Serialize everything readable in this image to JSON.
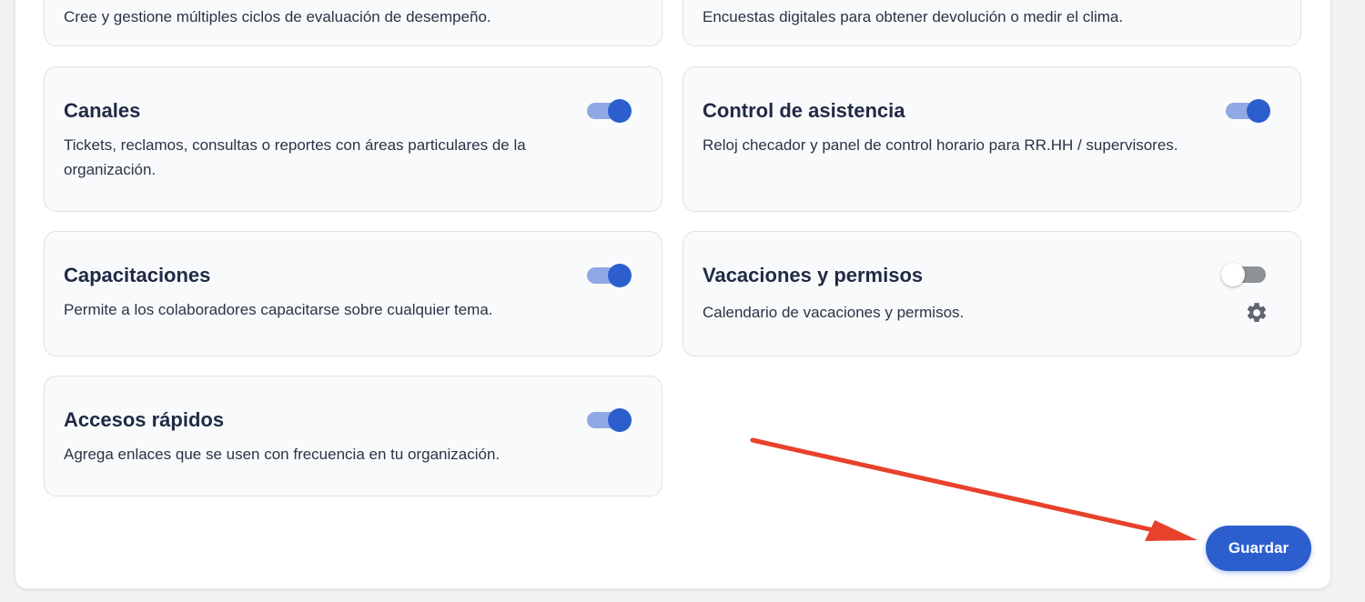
{
  "modules": [
    {
      "title": "",
      "description": "Cree y gestione múltiples ciclos de evaluación de desempeño."
    },
    {
      "title": "",
      "description": "Encuestas digitales para obtener devolución o medir el clima."
    },
    {
      "title": "Canales",
      "description": "Tickets, reclamos, consultas o reportes con áreas particulares de la organización.",
      "enabled": true
    },
    {
      "title": "Control de asistencia",
      "description": "Reloj checador y panel de control horario para RR.HH / supervisores.",
      "enabled": true
    },
    {
      "title": "Capacitaciones",
      "description": "Permite a los colaboradores capacitarse sobre cualquier tema.",
      "enabled": true
    },
    {
      "title": "Vacaciones y permisos",
      "description": "Calendario de vacaciones y permisos.",
      "enabled": false,
      "settings_icon": "gear-icon"
    },
    {
      "title": "Accesos rápidos",
      "description": "Agrega enlaces que se usen con frecuencia en tu organización.",
      "enabled": true
    }
  ],
  "save_button": {
    "label": "Guardar"
  },
  "colors": {
    "accent": "#2c5fcd",
    "toggle_track_on": "#8fa9e4",
    "toggle_track_off": "#8e9196",
    "annotation_arrow": "#e8412c"
  }
}
